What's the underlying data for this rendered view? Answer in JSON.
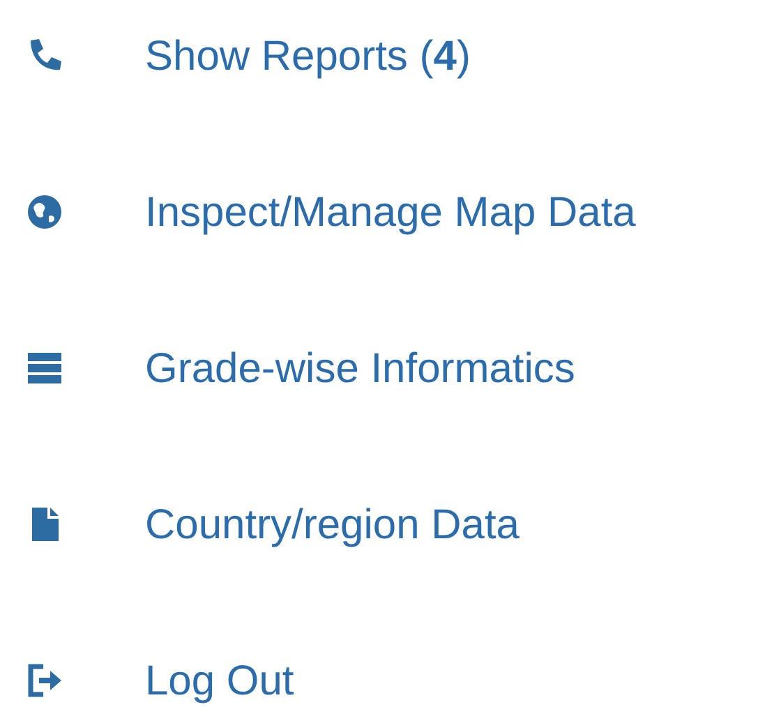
{
  "menu": [
    {
      "kind": "phone",
      "label": "Show Reports (**4**)"
    },
    {
      "kind": "globe",
      "label": "Inspect/Manage Map Data"
    },
    {
      "kind": "server",
      "label": "Grade-wise Informatics"
    },
    {
      "kind": "file",
      "label": "Country/region Data"
    },
    {
      "kind": "logout",
      "label": "Log Out"
    }
  ]
}
